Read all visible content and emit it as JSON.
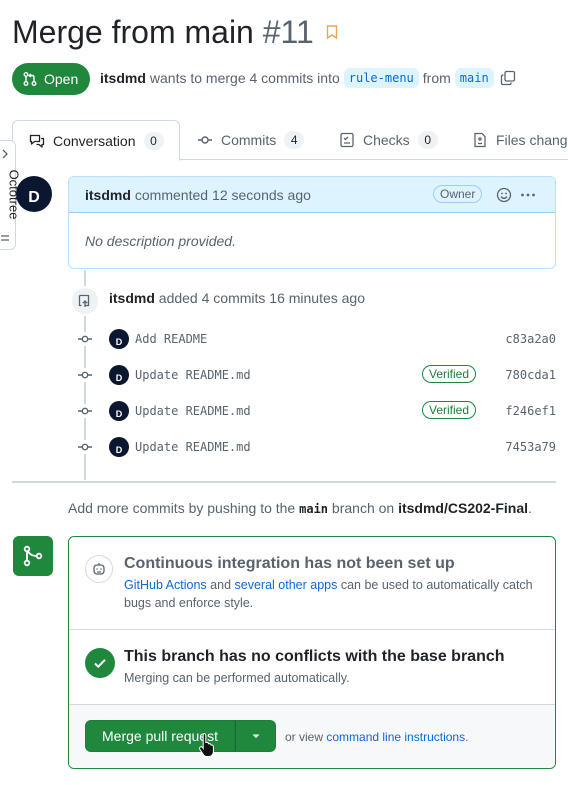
{
  "pr": {
    "title": "Merge from main",
    "number": "#11",
    "state": "Open",
    "author": "itsdmd",
    "merge_text": "wants to merge 4 commits into",
    "base_branch": "rule-menu",
    "from_text": "from",
    "head_branch": "main"
  },
  "tabs": [
    {
      "label": "Conversation",
      "count": "0"
    },
    {
      "label": "Commits",
      "count": "4"
    },
    {
      "label": "Checks",
      "count": "0"
    },
    {
      "label": "Files chang"
    }
  ],
  "octotree": {
    "label": "Octotree"
  },
  "avatar": {
    "initial": "D"
  },
  "comment": {
    "author": "itsdmd",
    "action": "commented",
    "time": "12 seconds ago",
    "role": "Owner",
    "body": "No description provided."
  },
  "commits_event": {
    "author": "itsdmd",
    "text": "added 4 commits 16 minutes ago"
  },
  "commits": [
    {
      "message": "Add README",
      "verified": "",
      "sha": "c83a2a0"
    },
    {
      "message": "Update README.md",
      "verified": "Verified",
      "sha": "780cda1"
    },
    {
      "message": "Update README.md",
      "verified": "Verified",
      "sha": "f246ef1"
    },
    {
      "message": "Update README.md",
      "verified": "",
      "sha": "7453a79"
    }
  ],
  "hint": {
    "prefix": "Add more commits by pushing to the",
    "branch": "main",
    "middle": "branch on",
    "repo": "itsdmd/CS202-Final",
    "suffix": "."
  },
  "merge_box": {
    "ci_title": "Continuous integration has not been set up",
    "ci_link1": "GitHub Actions",
    "ci_and": "and",
    "ci_link2": "several other apps",
    "ci_rest": "can be used to automatically catch bugs and enforce style.",
    "conflict_title": "This branch has no conflicts with the base branch",
    "conflict_desc": "Merging can be performed automatically.",
    "merge_button": "Merge pull request",
    "or_view": "or view",
    "cli_link": "command line instructions",
    "period": "."
  },
  "colors": {
    "open_green": "#1f883d",
    "link_blue": "#0969da",
    "branch_bg": "#ddf4ff"
  },
  "icons": [
    "pull-request-icon",
    "bookmark-icon",
    "copy-icon",
    "conversation-icon",
    "commit-icon",
    "checks-icon",
    "files-icon",
    "smiley-icon",
    "kebab-icon",
    "repo-push-icon",
    "git-merge-icon",
    "ci-icon",
    "check-icon",
    "triangle-down-icon",
    "pointer-cursor-icon"
  ]
}
